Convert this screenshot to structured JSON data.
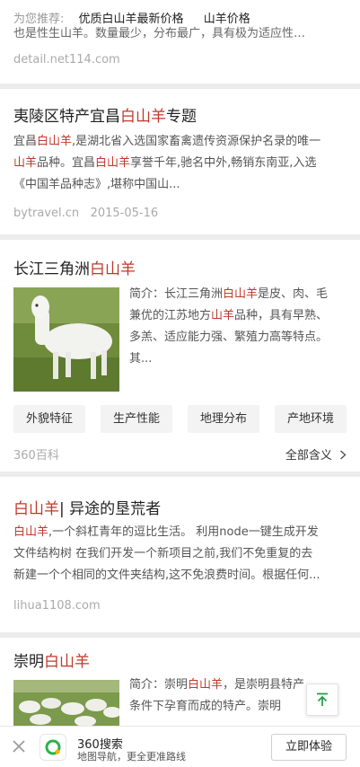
{
  "recommend": {
    "label": "为您推荐:",
    "links": [
      "优质白山羊最新价格",
      "山羊价格"
    ]
  },
  "result1": {
    "fragment": "也是性生山羊。数量最少，分布最广，具有极为适应性…",
    "source": "detail.net114.com"
  },
  "result2": {
    "title_pre": "夷陵区特产宜昌",
    "title_hl": "白山羊",
    "title_post": "专题",
    "line1_pre": "宜昌",
    "line1_hl": "白山羊",
    "line1_post": ",是湖北省入选国家畜禽遗传资源保护名录的唯一",
    "line2_hl1": "山羊",
    "line2_mid": "品种。宜昌",
    "line2_hl2": "白山羊",
    "line2_post": "享誉千年,驰名中外,畅销东南亚,入选",
    "line3": "《中国羊品种志》,堪称中国山...",
    "source": "bytravel.cn",
    "date": "2015-05-16"
  },
  "result3": {
    "title_pre": "长江三角洲",
    "title_hl": "白山羊",
    "l1_pre": "简介：长江三角洲",
    "l1_hl": "白山羊",
    "l1_post": "是皮、肉、毛",
    "l2_pre": "兼优的江苏地方",
    "l2_hl": "山羊",
    "l2_post": "品种，具有早熟、",
    "l3": "多羔、适应能力强、繁殖力高等特点。",
    "l4": "其...",
    "tags": [
      "外貌特征",
      "生产性能",
      "地理分布",
      "产地环境"
    ],
    "source": "360百科",
    "more": "全部含义"
  },
  "result4": {
    "title_hl": "白山羊",
    "title_post": "| 异途的垦荒者",
    "l1_hl": "白山羊",
    "l1_post": ",一个斜杠青年的逗比生活。 利用node一键生成开发",
    "l2": "文件结构树 在我们开发一个新项目之前,我们不免重复的去",
    "l3": "新建一个个相同的文件夹结构,这不免浪费时间。根据任何...",
    "source": "lihua1108.com"
  },
  "result5": {
    "title_pre": "崇明",
    "title_hl": "白山羊",
    "l1_pre": "简介：崇明",
    "l1_hl": "白山羊",
    "l1_post": "，是崇明县特产",
    "l2": "条件下孕育而成的特产。崇明"
  },
  "app_bar": {
    "name": "360搜索",
    "subtitle": "地图导航，更全更准路线",
    "button": "立即体验"
  },
  "colors": {
    "highlight": "#c0392b",
    "logo_green": "#2bb24c",
    "logo_yellow": "#f6b400"
  }
}
